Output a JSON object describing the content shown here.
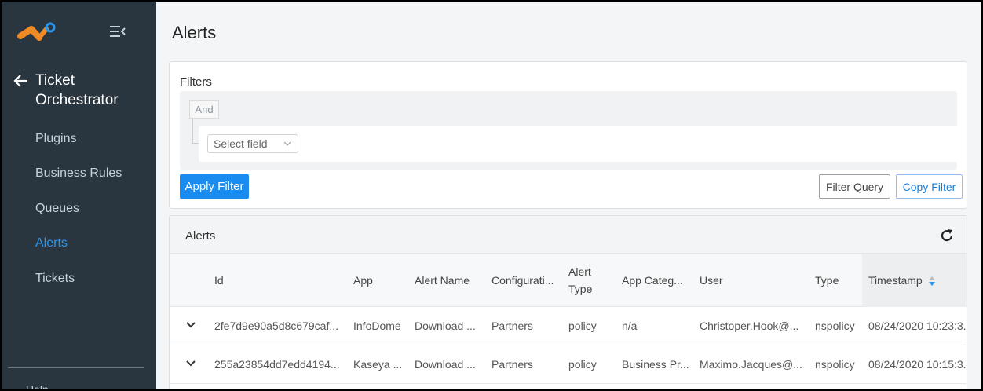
{
  "sidebar": {
    "back_title": "Ticket Orchestrator",
    "items": [
      {
        "label": "Plugins"
      },
      {
        "label": "Business Rules"
      },
      {
        "label": "Queues"
      },
      {
        "label": "Alerts",
        "active": true
      },
      {
        "label": "Tickets"
      }
    ],
    "help": "Help"
  },
  "main": {
    "title": "Alerts",
    "filters": {
      "label": "Filters",
      "operator": "And",
      "select_placeholder": "Select field",
      "apply_label": "Apply Filter",
      "filter_query_label": "Filter Query",
      "copy_filter_label": "Copy Filter"
    },
    "alerts": {
      "title": "Alerts",
      "columns": {
        "id": "Id",
        "app": "App",
        "alert_name": "Alert Name",
        "configuration": "Configurati...",
        "alert_type": "Alert Type",
        "app_category": "App Categ...",
        "user": "User",
        "type": "Type",
        "timestamp": "Timestamp"
      },
      "rows": [
        {
          "id": "2fe7d9e90a5d8c679caf...",
          "app": "InfoDome",
          "alert_name": "Download ...",
          "configuration": "Partners",
          "alert_type": "policy",
          "app_category": "n/a",
          "user": "Christoper.Hook@...",
          "type": "nspolicy",
          "timestamp": "08/24/2020 10:23:3..."
        },
        {
          "id": "255a23854dd7edd4194...",
          "app": "Kaseya ...",
          "alert_name": "Download ...",
          "configuration": "Partners",
          "alert_type": "policy",
          "app_category": "Business Pr...",
          "user": "Maximo.Jacques@...",
          "type": "nspolicy",
          "timestamp": "08/24/2020 10:15:3..."
        }
      ]
    }
  },
  "colors": {
    "sidebar_bg": "#293640",
    "accent": "#1a8cf0",
    "logo_orange": "#f08a24",
    "logo_blue": "#2b96f0"
  }
}
